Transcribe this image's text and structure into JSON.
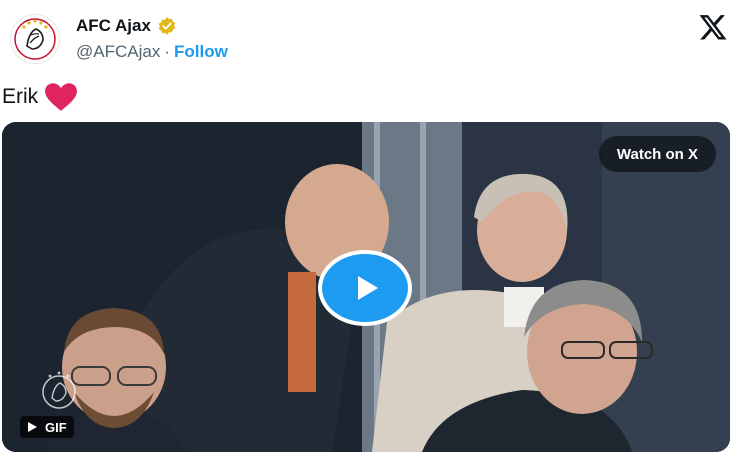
{
  "author": {
    "name": "AFC Ajax",
    "handle": "@AFCAjax",
    "separator": "·",
    "follow_label": "Follow",
    "avatar_icon": "ajax-crest-icon",
    "verified_icon": "verified-gold-badge-icon"
  },
  "header": {
    "logo_icon": "x-logo-icon"
  },
  "tweet": {
    "text": "Erik",
    "emoji_icon": "red-heart-icon"
  },
  "media": {
    "type": "gif",
    "watch_label": "Watch on X",
    "gif_label": "GIF",
    "play_icon": "play-icon",
    "watermark_icon": "ajax-crest-icon"
  },
  "colors": {
    "accent": "#1d9bf0",
    "verified_gold": "#e2b719",
    "heart": "#e0245e",
    "text": "#0f1419",
    "muted": "#536471"
  }
}
